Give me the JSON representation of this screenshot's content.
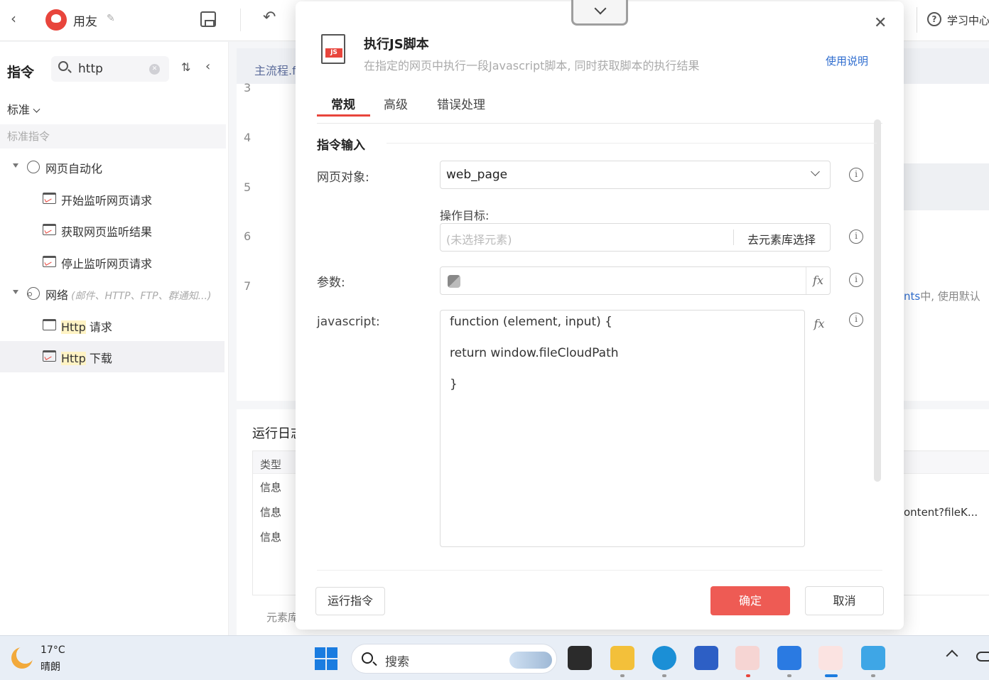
{
  "topbar": {
    "app_name": "用友",
    "help_label": "学习中心"
  },
  "left_panel": {
    "title": "指令",
    "search": {
      "value": "http"
    },
    "category": "标准",
    "section": "标准指令",
    "groups": [
      {
        "label": "网页自动化",
        "hint": "",
        "items": [
          "开始监听网页请求",
          "获取网页监听结果",
          "停止监听网页请求"
        ]
      },
      {
        "label": "网络",
        "hint": "(邮件、HTTP、FTP、群通知...)",
        "items": [
          {
            "hl": "Http",
            "rest": " 请求"
          },
          {
            "hl": "Http",
            "rest": " 下载"
          }
        ]
      }
    ]
  },
  "editor": {
    "tab": "主流程.f",
    "line_numbers": [
      "3",
      "4",
      "5",
      "6",
      "7"
    ]
  },
  "log": {
    "title": "运行日志",
    "head": "类型",
    "rows": [
      "信息",
      "信息",
      "信息"
    ],
    "footer": "元素库",
    "peek1_hl": "nts",
    "peek1_rest": "中, 使用默认",
    "peek2": "ontent?fileK..."
  },
  "dialog": {
    "title": "执行JS脚本",
    "description": "在指定的网页中执行一段Javascript脚本, 同时获取脚本的执行结果",
    "help_link": "使用说明",
    "tabs": [
      "常规",
      "高级",
      "错误处理"
    ],
    "section_title": "指令输入",
    "fields": {
      "web_object_label": "网页对象:",
      "web_object_value": "web_page",
      "target_label": "操作目标:",
      "target_placeholder": "(未选择元素)",
      "target_button": "去元素库选择",
      "params_label": "参数:",
      "js_label": "javascript:",
      "code_lines": [
        "function (element, input) {",
        "return window.fileCloudPath",
        "}"
      ]
    },
    "buttons": {
      "run": "运行指令",
      "ok": "确定",
      "cancel": "取消"
    }
  },
  "taskbar": {
    "temperature": "17°C",
    "weather": "晴朗",
    "search_label": "搜索"
  },
  "colors": {
    "accent": "#e8453c",
    "link": "#2f6dcf",
    "ok_button": "#ee5b54"
  }
}
